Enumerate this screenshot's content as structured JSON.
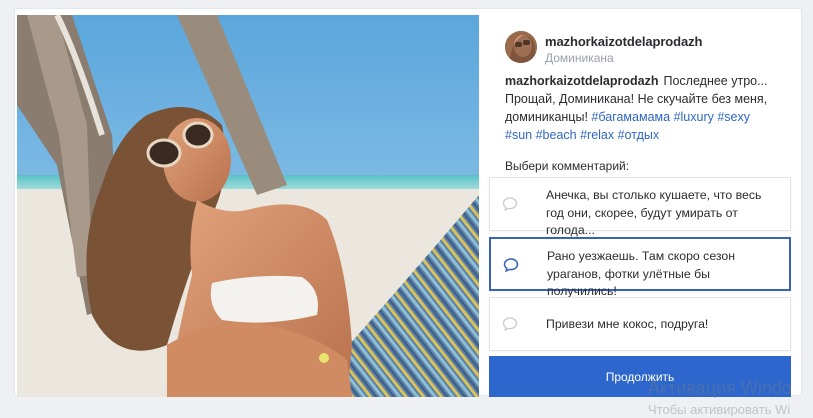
{
  "post": {
    "author": "mazhorkaizotdelaprodazh",
    "location": "Доминикана",
    "caption_user": "mazhorkaizotdelaprodazh",
    "caption_text": "Последнее утро... Прощай, Доминикана! Не скучайте без меня, доминиканцы!",
    "hashtags": [
      "#багамамама",
      "#luxury",
      "#sexy",
      "#sun",
      "#beach",
      "#relax",
      "#отдых"
    ]
  },
  "comments": {
    "label": "Выбери комментарий:",
    "options": [
      {
        "text": "Анечка, вы столько кушаете, что весь год они, скорее, будут умирать от голода...",
        "selected": false
      },
      {
        "text": "Рано уезжаешь. Там скоро сезон ураганов, фотки улётные бы получились!",
        "selected": true
      },
      {
        "text": "Привези мне кокос, подруга!",
        "selected": false
      }
    ],
    "continue_label": "Продолжить"
  },
  "watermark": {
    "line1": "Активация Windo",
    "line2": "Чтобы активировать Wi"
  },
  "colors": {
    "accent": "#2d66cc",
    "selected_border": "#3463b7",
    "hashtag": "#2f67c5"
  },
  "icons": {
    "comment_option": "speech-bubble-icon"
  }
}
